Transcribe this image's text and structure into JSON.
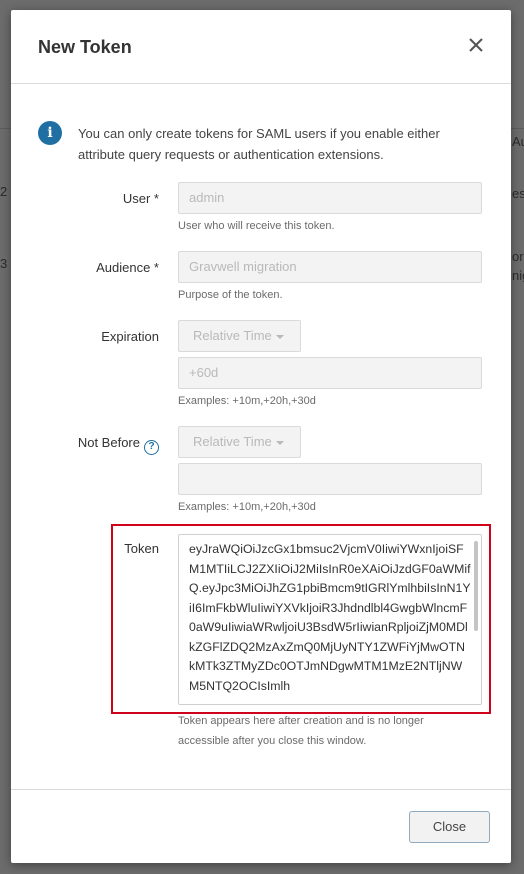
{
  "background": {
    "fragments": [
      "Au",
      "est",
      "or",
      "nig",
      "2",
      "3"
    ]
  },
  "modal": {
    "title": "New Token",
    "close_icon": "close-icon",
    "info": {
      "icon": "info-icon",
      "text": "You can only create tokens for SAML users if you enable either attribute query requests or authentication extensions."
    },
    "fields": {
      "user": {
        "label": "User *",
        "value": "admin",
        "help": "User who will receive this token."
      },
      "audience": {
        "label": "Audience *",
        "value": "Gravwell migration",
        "help": "Purpose of the token."
      },
      "expiration": {
        "label": "Expiration",
        "mode": "Relative Time",
        "value": "+60d",
        "help": "Examples: +10m,+20h,+30d"
      },
      "not_before": {
        "label": "Not Before",
        "help_icon": "question-circle-icon",
        "mode": "Relative Time",
        "value": "",
        "help": "Examples: +10m,+20h,+30d"
      },
      "token": {
        "label": "Token",
        "value": "eyJraWQiOiJzcGx1bmsuc2VjcmV0IiwiYWxnIjoiSFM1MTIiLCJ2ZXIiOiJ2MiIsInR0eXAiOiJzdGF0aWMifQ.eyJpc3MiOiJhZG1pbiBmcm9tIGRlYmlhbiIsInN1YiI6ImFkbWluIiwiYXVkIjoiR3Jhdndlbl4GwgbWlncmF0aW9uIiwiaWRwljoiU3BsdW5rIiwianRpljoiZjM0MDlkZGFlZDQ2MzAxZmQ0MjUyNTY1ZWFiYjMwOTNkMTk3ZTMyZDc0OTJmNDgwMTM1MzE2NTljNWM5NTQ2OCIsImlh",
        "help": "Token appears here after creation and is no longer accessible after you close this window."
      }
    },
    "footer": {
      "close_label": "Close"
    }
  },
  "colors": {
    "accent": "#1f6fa3",
    "highlight": "#d0021b"
  }
}
